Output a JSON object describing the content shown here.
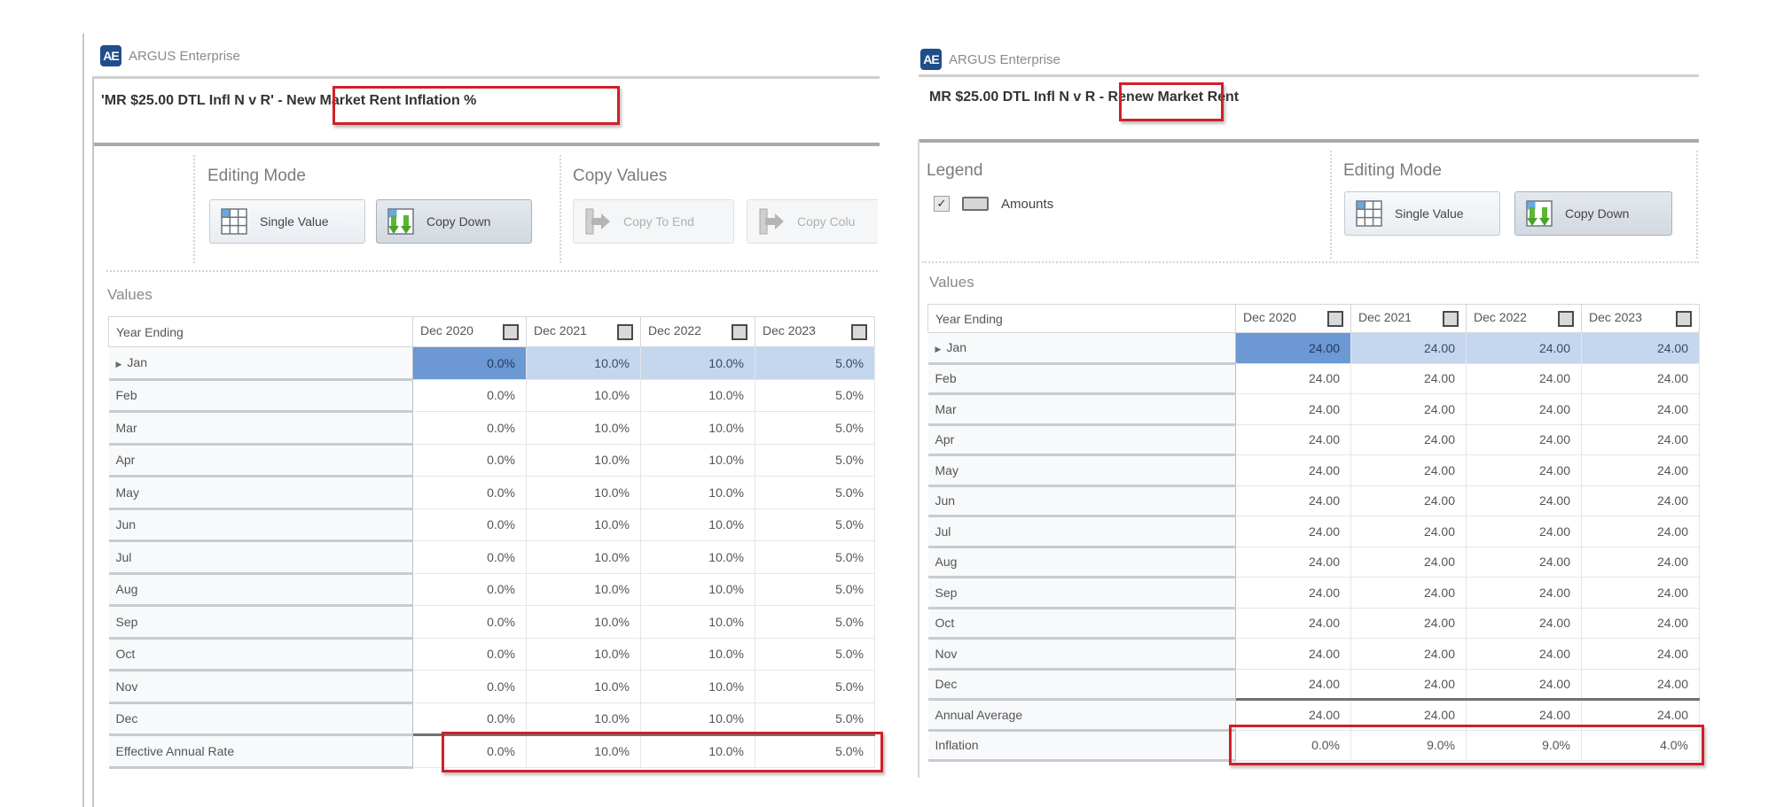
{
  "left": {
    "app_name": "ARGUS Enterprise",
    "logo_text": "AE",
    "title_prefix": "'MR $25.00 DTL Infl N v R' - ",
    "title_highlight": "New Market Rent Inflation %",
    "editing_mode": {
      "label": "Editing Mode",
      "buttons": [
        {
          "label": "Single Value",
          "icon": "grid-icon",
          "state": "normal"
        },
        {
          "label": "Copy Down",
          "icon": "copy-down-icon",
          "state": "active"
        }
      ]
    },
    "copy_values": {
      "label": "Copy Values",
      "buttons": [
        {
          "label": "Copy To End",
          "icon": "copy-right-arrow-icon",
          "state": "disabled"
        },
        {
          "label": "Copy Colu",
          "icon": "copy-right-arrow-icon",
          "state": "disabled"
        }
      ]
    },
    "values_label": "Values",
    "table": {
      "header": "Year Ending",
      "columns": [
        "Dec 2020",
        "Dec 2021",
        "Dec 2022",
        "Dec 2023"
      ],
      "rows": [
        {
          "label": "Jan",
          "expandable": true,
          "selected": true,
          "values": [
            "0.0%",
            "10.0%",
            "10.0%",
            "5.0%"
          ]
        },
        {
          "label": "Feb",
          "values": [
            "0.0%",
            "10.0%",
            "10.0%",
            "5.0%"
          ]
        },
        {
          "label": "Mar",
          "values": [
            "0.0%",
            "10.0%",
            "10.0%",
            "5.0%"
          ]
        },
        {
          "label": "Apr",
          "values": [
            "0.0%",
            "10.0%",
            "10.0%",
            "5.0%"
          ]
        },
        {
          "label": "May",
          "values": [
            "0.0%",
            "10.0%",
            "10.0%",
            "5.0%"
          ]
        },
        {
          "label": "Jun",
          "values": [
            "0.0%",
            "10.0%",
            "10.0%",
            "5.0%"
          ]
        },
        {
          "label": "Jul",
          "values": [
            "0.0%",
            "10.0%",
            "10.0%",
            "5.0%"
          ]
        },
        {
          "label": "Aug",
          "values": [
            "0.0%",
            "10.0%",
            "10.0%",
            "5.0%"
          ]
        },
        {
          "label": "Sep",
          "values": [
            "0.0%",
            "10.0%",
            "10.0%",
            "5.0%"
          ]
        },
        {
          "label": "Oct",
          "values": [
            "0.0%",
            "10.0%",
            "10.0%",
            "5.0%"
          ]
        },
        {
          "label": "Nov",
          "values": [
            "0.0%",
            "10.0%",
            "10.0%",
            "5.0%"
          ]
        },
        {
          "label": "Dec",
          "values": [
            "0.0%",
            "10.0%",
            "10.0%",
            "5.0%"
          ]
        },
        {
          "label": "Effective Annual Rate",
          "summary": true,
          "values": [
            "0.0%",
            "10.0%",
            "10.0%",
            "5.0%"
          ]
        }
      ]
    }
  },
  "right": {
    "app_name": "ARGUS Enterprise",
    "logo_text": "AE",
    "title_prefix": "MR $25.00 DTL Infl N v R - ",
    "title_highlight": "Renew Market Rent",
    "legend": {
      "label": "Legend",
      "items": [
        {
          "label": "Amounts",
          "checked": true
        }
      ]
    },
    "editing_mode": {
      "label": "Editing Mode",
      "buttons": [
        {
          "label": "Single Value",
          "icon": "grid-icon",
          "state": "normal"
        },
        {
          "label": "Copy Down",
          "icon": "copy-down-icon",
          "state": "active"
        }
      ]
    },
    "values_label": "Values",
    "table": {
      "header": "Year Ending",
      "columns": [
        "Dec 2020",
        "Dec 2021",
        "Dec 2022",
        "Dec 2023"
      ],
      "rows": [
        {
          "label": "Jan",
          "expandable": true,
          "selected": true,
          "values": [
            "24.00",
            "24.00",
            "24.00",
            "24.00"
          ]
        },
        {
          "label": "Feb",
          "values": [
            "24.00",
            "24.00",
            "24.00",
            "24.00"
          ]
        },
        {
          "label": "Mar",
          "values": [
            "24.00",
            "24.00",
            "24.00",
            "24.00"
          ]
        },
        {
          "label": "Apr",
          "values": [
            "24.00",
            "24.00",
            "24.00",
            "24.00"
          ]
        },
        {
          "label": "May",
          "values": [
            "24.00",
            "24.00",
            "24.00",
            "24.00"
          ]
        },
        {
          "label": "Jun",
          "values": [
            "24.00",
            "24.00",
            "24.00",
            "24.00"
          ]
        },
        {
          "label": "Jul",
          "values": [
            "24.00",
            "24.00",
            "24.00",
            "24.00"
          ]
        },
        {
          "label": "Aug",
          "values": [
            "24.00",
            "24.00",
            "24.00",
            "24.00"
          ]
        },
        {
          "label": "Sep",
          "values": [
            "24.00",
            "24.00",
            "24.00",
            "24.00"
          ]
        },
        {
          "label": "Oct",
          "values": [
            "24.00",
            "24.00",
            "24.00",
            "24.00"
          ]
        },
        {
          "label": "Nov",
          "values": [
            "24.00",
            "24.00",
            "24.00",
            "24.00"
          ]
        },
        {
          "label": "Dec",
          "values": [
            "24.00",
            "24.00",
            "24.00",
            "24.00"
          ]
        },
        {
          "label": "Annual Average",
          "summary": true,
          "values": [
            "24.00",
            "24.00",
            "24.00",
            "24.00"
          ]
        },
        {
          "label": "Inflation",
          "values": [
            "0.0%",
            "9.0%",
            "9.0%",
            "4.0%"
          ]
        }
      ]
    }
  },
  "colors": {
    "highlight_box": "#d0202a",
    "selected_cell": "#6c98d3",
    "selected_row": "#c5d7ef",
    "logo": "#1f4e8c"
  }
}
